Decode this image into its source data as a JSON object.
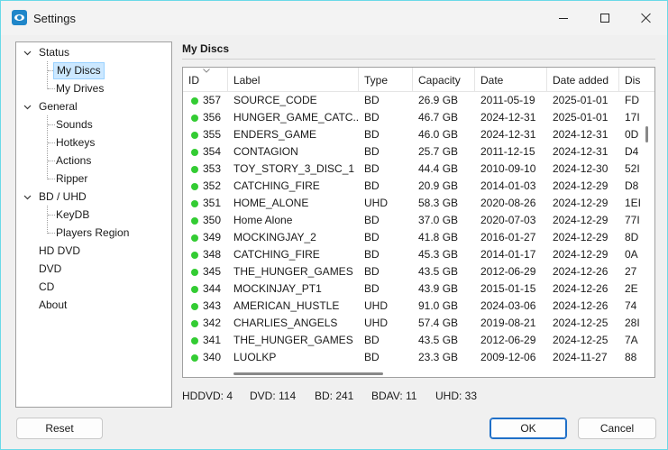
{
  "window": {
    "title": "Settings",
    "icon": "eye-disc-icon",
    "accent_color": "#1f86c9"
  },
  "tree": {
    "items": [
      {
        "label": "Status",
        "expanded": true
      },
      {
        "label": "My Discs",
        "selected": true
      },
      {
        "label": "My Drives"
      },
      {
        "label": "General",
        "expanded": true
      },
      {
        "label": "Sounds"
      },
      {
        "label": "Hotkeys"
      },
      {
        "label": "Actions"
      },
      {
        "label": "Ripper"
      },
      {
        "label": "BD / UHD",
        "expanded": true
      },
      {
        "label": "KeyDB"
      },
      {
        "label": "Players Region"
      },
      {
        "label": "HD DVD"
      },
      {
        "label": "DVD"
      },
      {
        "label": "CD"
      },
      {
        "label": "About"
      }
    ]
  },
  "panel": {
    "title": "My Discs"
  },
  "table": {
    "columns": [
      "ID",
      "Label",
      "Type",
      "Capacity",
      "Date",
      "Date added",
      "Dis"
    ],
    "sort_column": "ID",
    "sort_direction": "descending",
    "status_color": "#33cc33",
    "rows": [
      [
        "357",
        "SOURCE_CODE",
        "BD",
        "26.9 GB",
        "2011-05-19",
        "2025-01-01",
        "FD"
      ],
      [
        "356",
        "HUNGER_GAME_CATC...",
        "BD",
        "46.7 GB",
        "2024-12-31",
        "2025-01-01",
        "17I"
      ],
      [
        "355",
        "ENDERS_GAME",
        "BD",
        "46.0 GB",
        "2024-12-31",
        "2024-12-31",
        "0D"
      ],
      [
        "354",
        "CONTAGION",
        "BD",
        "25.7 GB",
        "2011-12-15",
        "2024-12-31",
        "D4"
      ],
      [
        "353",
        "TOY_STORY_3_DISC_1",
        "BD",
        "44.4 GB",
        "2010-09-10",
        "2024-12-30",
        "52I"
      ],
      [
        "352",
        "CATCHING_FIRE",
        "BD",
        "20.9 GB",
        "2014-01-03",
        "2024-12-29",
        "D8"
      ],
      [
        "351",
        "HOME_ALONE",
        "UHD",
        "58.3 GB",
        "2020-08-26",
        "2024-12-29",
        "1EI"
      ],
      [
        "350",
        "Home Alone",
        "BD",
        "37.0 GB",
        "2020-07-03",
        "2024-12-29",
        "77I"
      ],
      [
        "349",
        "MOCKINGJAY_2",
        "BD",
        "41.8 GB",
        "2016-01-27",
        "2024-12-29",
        "8D"
      ],
      [
        "348",
        "CATCHING_FIRE",
        "BD",
        "45.3 GB",
        "2014-01-17",
        "2024-12-29",
        "0A"
      ],
      [
        "345",
        "THE_HUNGER_GAMES",
        "BD",
        "43.5 GB",
        "2012-06-29",
        "2024-12-26",
        "27"
      ],
      [
        "344",
        "MOCKINJAY_PT1",
        "BD",
        "43.9 GB",
        "2015-01-15",
        "2024-12-26",
        "2E"
      ],
      [
        "343",
        "AMERICAN_HUSTLE",
        "UHD",
        "91.0 GB",
        "2024-03-06",
        "2024-12-26",
        "74"
      ],
      [
        "342",
        "CHARLIES_ANGELS",
        "UHD",
        "57.4 GB",
        "2019-08-21",
        "2024-12-25",
        "28I"
      ],
      [
        "341",
        "THE_HUNGER_GAMES",
        "BD",
        "43.5 GB",
        "2012-06-29",
        "2024-12-25",
        "7A"
      ],
      [
        "340",
        "LUOLKP",
        "BD",
        "23.3 GB",
        "2009-12-06",
        "2024-11-27",
        "88"
      ]
    ]
  },
  "status_bar": {
    "hddvd": "HDDVD: 4",
    "dvd": "DVD: 114",
    "bd": "BD: 241",
    "bdav": "BDAV: 11",
    "uhd": "UHD: 33"
  },
  "buttons": {
    "reset": "Reset",
    "ok": "OK",
    "cancel": "Cancel"
  }
}
